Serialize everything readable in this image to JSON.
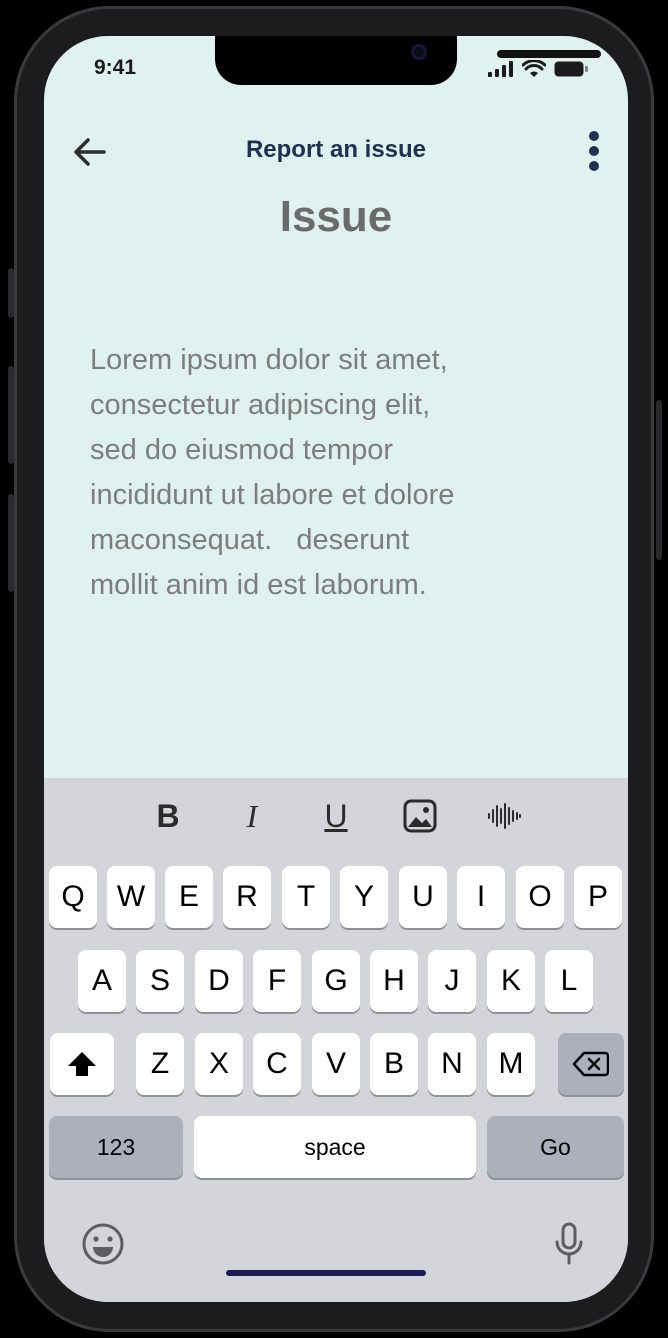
{
  "status_bar": {
    "time": "9:41"
  },
  "header": {
    "title": "Report an issue"
  },
  "page": {
    "title": "Issue",
    "body_lines": [
      "Lorem ipsum dolor sit amet,",
      "consectetur adipiscing elit,",
      "sed do eiusmod tempor",
      "incididunt ut labore et dolore",
      "maconsequat.   deserunt",
      "mollit anim id est laborum."
    ]
  },
  "toolbar": {
    "bold": "B",
    "italic": "I",
    "underline": "U"
  },
  "keyboard": {
    "row1": [
      "Q",
      "W",
      "E",
      "R",
      "T",
      "Y",
      "U",
      "I",
      "O",
      "P"
    ],
    "row2": [
      "A",
      "S",
      "D",
      "F",
      "G",
      "H",
      "J",
      "K",
      "L"
    ],
    "row3": [
      "Z",
      "X",
      "C",
      "V",
      "B",
      "N",
      "M"
    ],
    "numbers_key": "123",
    "space_key": "space",
    "go_key": "Go"
  },
  "colors": {
    "screen_bg": "#dff2ef",
    "title": "#1f3150",
    "home_indicator": "#1b1b58"
  },
  "icons": [
    "back-arrow-icon",
    "more-vertical-icon",
    "image-icon",
    "audio-wave-icon",
    "shift-icon",
    "backspace-icon",
    "emoji-icon",
    "microphone-icon",
    "signal-icon",
    "wifi-icon",
    "battery-icon"
  ]
}
